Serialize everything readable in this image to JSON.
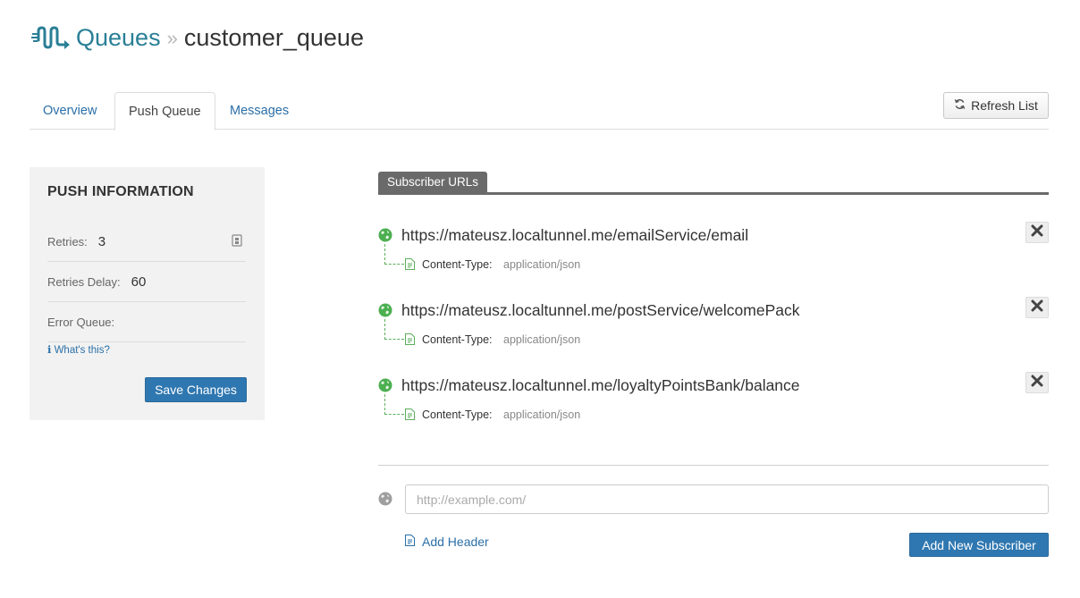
{
  "header": {
    "root": "Queues",
    "separator": "»",
    "current": "customer_queue"
  },
  "tabs": [
    {
      "label": "Overview",
      "active": false
    },
    {
      "label": "Push Queue",
      "active": true
    },
    {
      "label": "Messages",
      "active": false
    }
  ],
  "toolbar": {
    "refresh_label": "Refresh List",
    "refresh_icon": "refresh-icon"
  },
  "push_info": {
    "title": "PUSH INFORMATION",
    "fields": [
      {
        "label": "Retries:",
        "value": "3"
      },
      {
        "label": "Retries Delay:",
        "value": "60"
      },
      {
        "label": "Error Queue:",
        "value": ""
      }
    ],
    "whats_this": "What's this?",
    "whats_this_icon": "ℹ",
    "save_label": "Save Changes"
  },
  "subscribers": {
    "section_label": "Subscriber URLs",
    "items": [
      {
        "url": "https://mateusz.localtunnel.me/emailService/email",
        "header_key": "Content-Type:",
        "header_value": "application/json"
      },
      {
        "url": "https://mateusz.localtunnel.me/postService/welcomePack",
        "header_key": "Content-Type:",
        "header_value": "application/json"
      },
      {
        "url": "https://mateusz.localtunnel.me/loyaltyPointsBank/balance",
        "header_key": "Content-Type:",
        "header_value": "application/json"
      }
    ],
    "new_url_placeholder": "http://example.com/",
    "add_header_label": "Add Header",
    "add_subscriber_label": "Add New Subscriber"
  },
  "colors": {
    "link": "#2a6fa8",
    "brand": "#2a7f96",
    "primary_button": "#2f77b0",
    "status_green": "#4caf50",
    "section_gray": "#6a6a6a"
  }
}
